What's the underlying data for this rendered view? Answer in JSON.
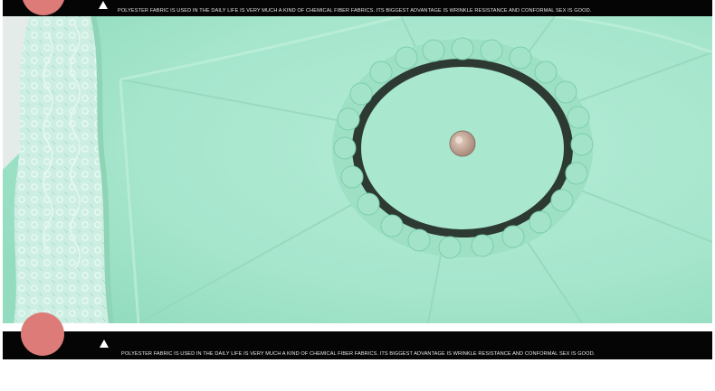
{
  "banners": {
    "top": {
      "caption": "POLYESTER FABRIC IS USED IN THE DAILY LIFE IS VERY MUCH A KIND OF CHEMICAL FIBER FABRICS. ITS BIGGEST ADVANTAGE IS WRINKLE RESISTANCE AND CONFORMAL SEX IS GOOD."
    },
    "bottom": {
      "caption": "POLYESTER FABRIC IS USED IN THE DAILY LIFE IS VERY MUCH A KIND OF CHEMICAL FIBER FABRICS. ITS BIGGEST ADVANTAGE IS WRINKLE RESISTANCE AND CONFORMAL SEX IS GOOD."
    }
  },
  "colors": {
    "canopy": "#a9e8cf",
    "accent_circle": "#dd7b78",
    "banner_bg": "#050505",
    "lace": "#c9ece0",
    "ruffle": "#8fd8b8",
    "cap": "#c9a997"
  },
  "icons": {
    "banner_marker": "triangle-up-icon",
    "banner_bullet": "circle-icon"
  }
}
